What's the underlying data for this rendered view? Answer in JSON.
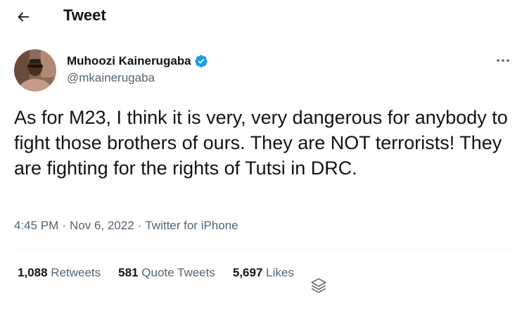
{
  "header": {
    "back_icon": "arrow-left-icon",
    "title": "Tweet"
  },
  "author": {
    "display_name": "Muhoozi Kainerugaba",
    "handle": "@mkainerugaba",
    "verified_icon": "verified-badge-icon",
    "verified_color": "#1d9bf0",
    "more_icon": "more-horizontal-icon"
  },
  "tweet": {
    "text": "As for M23, I think it is very, very dangerous for anybody to fight those brothers of ours. They are NOT terrorists! They are fighting for the rights of Tutsi in DRC.",
    "time": "4:45 PM",
    "separator": "·",
    "date": "Nov 6, 2022",
    "source": "Twitter for iPhone"
  },
  "stats": {
    "retweets_count": "1,088",
    "retweets_label": "Retweets",
    "quotes_count": "581",
    "quotes_label": "Quote Tweets",
    "likes_count": "5,697",
    "likes_label": "Likes"
  },
  "colors": {
    "text_primary": "#0f1419",
    "text_secondary": "#536471",
    "divider": "#eff3f4",
    "accent": "#1d9bf0"
  },
  "icons": {
    "layers": "layers-icon"
  }
}
